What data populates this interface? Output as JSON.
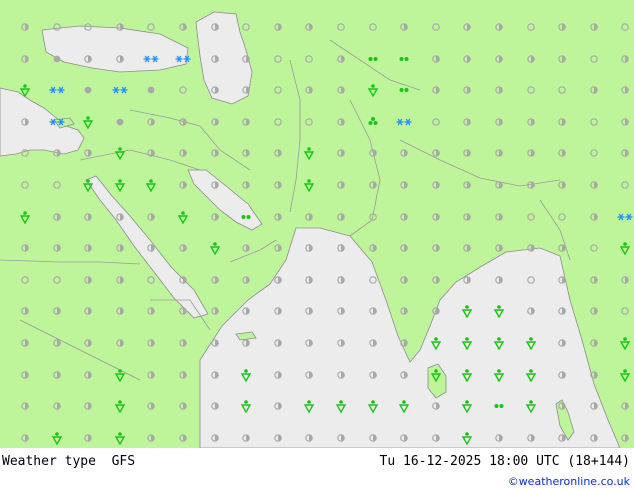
{
  "footer": {
    "product": "Weather type",
    "model": "GFS",
    "valid_time": "Tu 16-12-2025 18:00 UTC (18+144)",
    "credit": "©weatheronline.co.uk"
  },
  "colors": {
    "land": "#bff59a",
    "sea": "#ececec",
    "border": "#9a9a9a",
    "coast": "#8c8c8c",
    "dot_dry": "#a8a8a8",
    "rain": "#19c419",
    "snow": "#1e90ff"
  },
  "legend_symbols": {
    "dot": "dry",
    "ring": "partly-cloudy",
    "half": "cloudy",
    "rain": "rain-shower",
    "drizzle": "drizzle",
    "snow": "snow",
    "snowrain": "sleet"
  }
}
